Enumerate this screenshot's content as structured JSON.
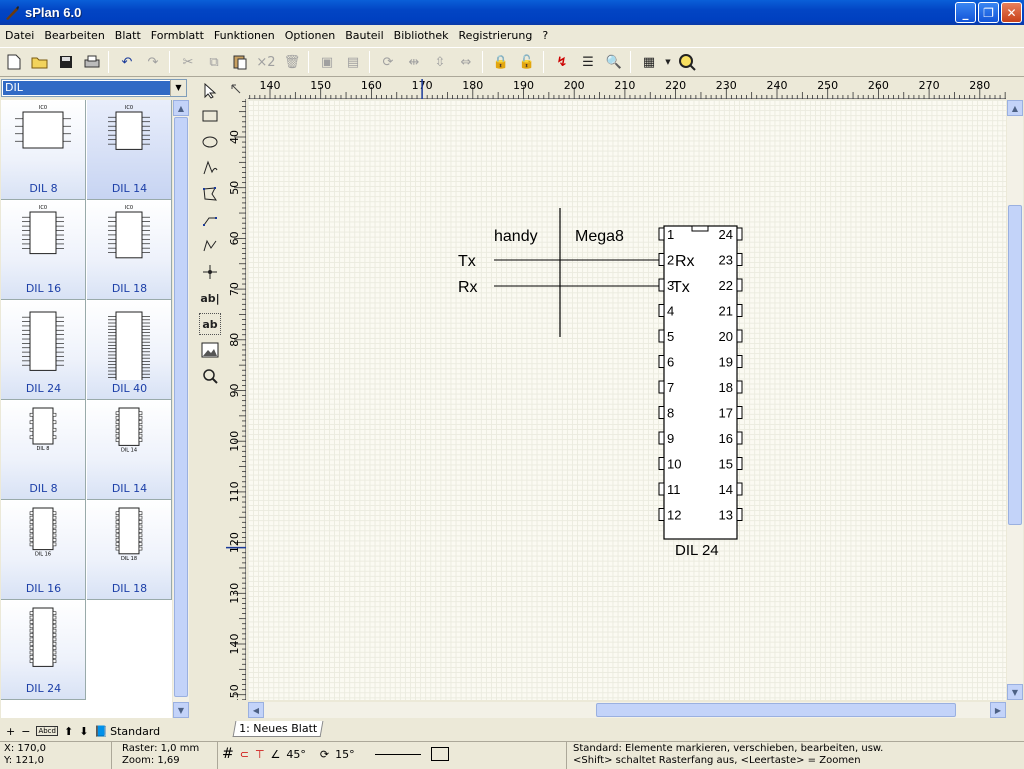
{
  "window": {
    "title": "sPlan 6.0"
  },
  "menu": [
    "Datei",
    "Bearbeiten",
    "Blatt",
    "Formblatt",
    "Funktionen",
    "Optionen",
    "Bauteil",
    "Bibliothek",
    "Registrierung",
    "?"
  ],
  "toolbar": {
    "icons": [
      "new-icon",
      "open-icon",
      "save-icon",
      "print-icon",
      "undo-icon",
      "redo-icon",
      "cut-icon",
      "copy-icon",
      "paste-icon",
      "times2-icon",
      "delete-icon",
      "group-icon",
      "ungroup-icon",
      "rotate-icon",
      "mirror-h-icon",
      "mirror-v-icon",
      "flip-icon",
      "lock-icon",
      "unlock-icon",
      "numbering-icon",
      "parts-list-icon",
      "search-icon",
      "grid-icon",
      "zoom-icon"
    ],
    "times2_label": "×2"
  },
  "library": {
    "selected": "DIL",
    "items": [
      {
        "label": "DIL 8",
        "chip_label": "IC0",
        "pins": 8,
        "style": "symbol",
        "selected": false
      },
      {
        "label": "DIL 14",
        "chip_label": "IC0",
        "pins": 14,
        "style": "symbol",
        "selected": true
      },
      {
        "label": "DIL 16",
        "chip_label": "IC0",
        "pins": 16,
        "style": "symbol",
        "selected": false
      },
      {
        "label": "DIL 18",
        "chip_label": "IC0",
        "pins": 18,
        "style": "symbol",
        "selected": false
      },
      {
        "label": "DIL 24",
        "chip_label": "",
        "pins": 24,
        "style": "symbol",
        "selected": false
      },
      {
        "label": "DIL 40",
        "chip_label": "",
        "pins": 40,
        "style": "symbol",
        "selected": false
      },
      {
        "label": "DIL 8",
        "chip_label": "DIL 8",
        "pins": 8,
        "style": "package",
        "selected": false
      },
      {
        "label": "DIL 14",
        "chip_label": "DIL 14",
        "pins": 14,
        "style": "package",
        "selected": false
      },
      {
        "label": "DIL 16",
        "chip_label": "DIL 16",
        "pins": 16,
        "style": "package",
        "selected": false
      },
      {
        "label": "DIL 18",
        "chip_label": "DIL 18",
        "pins": 18,
        "style": "package",
        "selected": false
      },
      {
        "label": "DIL 24",
        "chip_label": "",
        "pins": 24,
        "style": "package",
        "selected": false
      }
    ],
    "bottom_bar": {
      "standard_label": "Standard"
    }
  },
  "tools": [
    "select-tool-icon",
    "rectangle-tool-icon",
    "ellipse-tool-icon",
    "freehand-tool-icon",
    "polygon-tool-icon",
    "line-tool-icon",
    "bezier-tool-icon",
    "junction-tool-icon",
    "text-tool-icon",
    "textbox-tool-icon",
    "image-tool-icon",
    "zoom-tool-icon"
  ],
  "rulers": {
    "horizontal": [
      "140",
      "150",
      "160",
      "170",
      "180",
      "190",
      "200",
      "210",
      "220",
      "230",
      "240",
      "250",
      "260",
      "270",
      "280"
    ],
    "vertical": [
      "40",
      "50",
      "60",
      "70",
      "80",
      "90",
      "100",
      "110",
      "120",
      "130",
      "140",
      "150"
    ]
  },
  "schematic": {
    "header_left": "handy",
    "header_right": "Mega8",
    "left_labels": [
      "Tx",
      "Rx"
    ],
    "ic_label": "DIL 24",
    "ic_pin_labels": [
      "Rx",
      "Tx"
    ],
    "left_pins": [
      "1",
      "2",
      "3",
      "4",
      "5",
      "6",
      "7",
      "8",
      "9",
      "10",
      "11",
      "12"
    ],
    "right_pins": [
      "24",
      "23",
      "22",
      "21",
      "20",
      "19",
      "18",
      "17",
      "16",
      "15",
      "14",
      "13"
    ]
  },
  "sheet_tab": "1: Neues Blatt",
  "status": {
    "x": "X: 170,0",
    "y": "Y: 121,0",
    "raster": "Raster: 1,0 mm",
    "zoom": "Zoom:   1,69",
    "angle1": "45°",
    "angle2": "15°",
    "hint1": "Standard: Elemente markieren, verschieben, bearbeiten, usw.",
    "hint2": "<Shift> schaltet Rasterfang aus, <Leertaste> = Zoomen"
  }
}
